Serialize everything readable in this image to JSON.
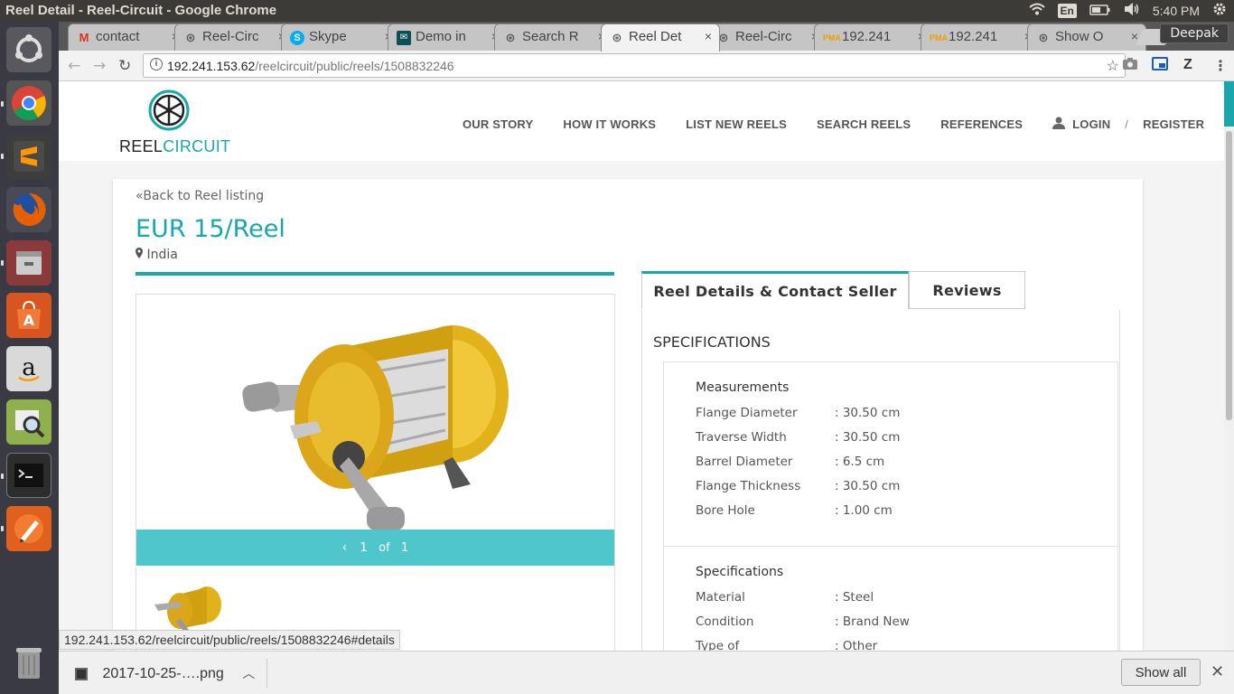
{
  "os": {
    "window_title": "Reel Detail - Reel-Circuit - Google Chrome",
    "tray": {
      "lang": "En",
      "time": "5:40 PM"
    }
  },
  "browser": {
    "tabs": [
      {
        "label": "contact",
        "icon": "gmail-icon"
      },
      {
        "label": "Reel-Circ",
        "icon": "wheel-icon"
      },
      {
        "label": "Skype",
        "icon": "skype-icon"
      },
      {
        "label": "Demo in",
        "icon": "mail-icon"
      },
      {
        "label": "Search R",
        "icon": "wheel-icon"
      },
      {
        "label": "Reel Det",
        "icon": "wheel-icon",
        "active": true
      },
      {
        "label": "Reel-Circ",
        "icon": "wheel-icon"
      },
      {
        "label": "192.241",
        "icon": "pma-icon"
      },
      {
        "label": "192.241",
        "icon": "pma-icon"
      },
      {
        "label": "Show O",
        "icon": "wheel-icon"
      }
    ],
    "profile": "Deepak",
    "url_host": "192.241.153.62",
    "url_path": "/reelcircuit/public/reels/1508832246",
    "status_url": "192.241.153.62/reelcircuit/public/reels/1508832246#details",
    "download": {
      "filename": "2017-10-25-….png",
      "show_all": "Show all"
    }
  },
  "site": {
    "logo_left": "REEL",
    "logo_right": "CIRCUIT",
    "nav": [
      "OUR STORY",
      "HOW IT WORKS",
      "LIST NEW REELS",
      "SEARCH REELS",
      "REFERENCES"
    ],
    "login": "LOGIN",
    "separator": "/",
    "register": "REGISTER",
    "accent": "#1aa7ac"
  },
  "reel": {
    "back": "Back to Reel listing",
    "price": "EUR 15/Reel",
    "location": "India",
    "pager": {
      "current": "1",
      "of": "of",
      "total": "1"
    },
    "tabs": [
      "Reel Details & Contact Seller",
      "Reviews"
    ],
    "spec_title": "SPECIFICATIONS",
    "measurements": {
      "title": "Measurements",
      "rows": [
        {
          "k": "Flange Diameter",
          "v": ": 30.50 cm"
        },
        {
          "k": "Traverse Width",
          "v": ": 30.50 cm"
        },
        {
          "k": "Barrel Diameter",
          "v": ": 6.5 cm"
        },
        {
          "k": "Flange Thickness",
          "v": ": 30.50 cm"
        },
        {
          "k": "Bore Hole",
          "v": ": 1.00 cm"
        }
      ]
    },
    "specifications": {
      "title": "Specifications",
      "rows": [
        {
          "k": "Material",
          "v": ": Steel"
        },
        {
          "k": "Condition",
          "v": ": Brand New"
        },
        {
          "k": "Type of",
          "v": ": Other"
        }
      ]
    }
  }
}
